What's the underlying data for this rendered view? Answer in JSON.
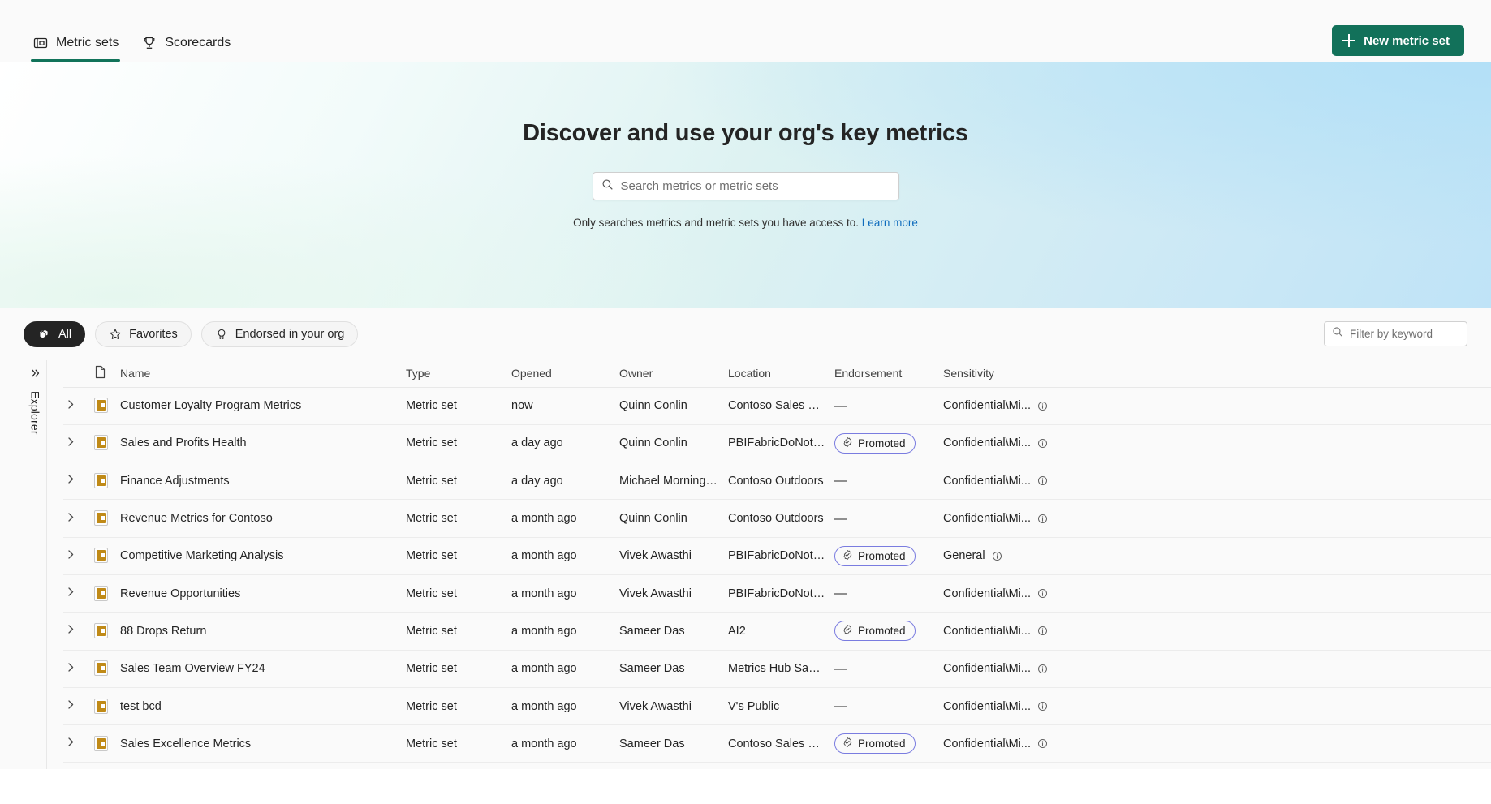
{
  "topbar": {
    "tabs": [
      {
        "label": "Metric sets",
        "icon": "metric-sets-icon",
        "active": true
      },
      {
        "label": "Scorecards",
        "icon": "trophy-icon",
        "active": false
      }
    ],
    "new_button": {
      "label": "New metric set",
      "icon": "plus-icon",
      "color": "#12715a"
    }
  },
  "hero": {
    "title": "Discover and use your org's key metrics",
    "search": {
      "placeholder": "Search metrics or metric sets",
      "value": "",
      "icon": "search-icon"
    },
    "note": "Only searches metrics and metric sets you have access to.",
    "note_link": "Learn more"
  },
  "filters": {
    "pills": [
      {
        "label": "All",
        "icon": "stacked-layers-icon",
        "active": true
      },
      {
        "label": "Favorites",
        "icon": "star-icon",
        "active": false
      },
      {
        "label": "Endorsed in your org",
        "icon": "endorsement-badge-icon",
        "active": false
      }
    ],
    "keyword": {
      "placeholder": "Filter by keyword",
      "value": "",
      "icon": "search-icon"
    }
  },
  "explorer": {
    "label": "Explorer",
    "icon": "double-chevron-right-icon"
  },
  "table": {
    "columns": [
      "Name",
      "Type",
      "Opened",
      "Owner",
      "Location",
      "Endorsement",
      "Sensitivity"
    ],
    "rows": [
      {
        "name": "Customer Loyalty Program Metrics",
        "type": "Metric set",
        "opened": "now",
        "owner": "Quinn Conlin",
        "location": "Contoso Sales Dem...",
        "endorsement": "—",
        "sensitivity": "Confidential\\Mi..."
      },
      {
        "name": "Sales and Profits Health",
        "type": "Metric set",
        "opened": "a day ago",
        "owner": "Quinn Conlin",
        "location": "PBIFabricDoNotDelete",
        "endorsement": "Promoted",
        "sensitivity": "Confidential\\Mi..."
      },
      {
        "name": "Finance Adjustments",
        "type": "Metric set",
        "opened": "a day ago",
        "owner": "Michael Morningstar",
        "location": "Contoso Outdoors",
        "endorsement": "—",
        "sensitivity": "Confidential\\Mi..."
      },
      {
        "name": "Revenue Metrics for Contoso",
        "type": "Metric set",
        "opened": "a month ago",
        "owner": "Quinn Conlin",
        "location": "Contoso Outdoors",
        "endorsement": "—",
        "sensitivity": "Confidential\\Mi..."
      },
      {
        "name": "Competitive Marketing Analysis",
        "type": "Metric set",
        "opened": "a month ago",
        "owner": "Vivek Awasthi",
        "location": "PBIFabricDoNotDelete",
        "endorsement": "Promoted",
        "sensitivity": "General"
      },
      {
        "name": "Revenue Opportunities",
        "type": "Metric set",
        "opened": "a month ago",
        "owner": "Vivek Awasthi",
        "location": "PBIFabricDoNotDelete",
        "endorsement": "—",
        "sensitivity": "Confidential\\Mi..."
      },
      {
        "name": "88 Drops Return",
        "type": "Metric set",
        "opened": "a month ago",
        "owner": "Sameer Das",
        "location": "AI2",
        "endorsement": "Promoted",
        "sensitivity": "Confidential\\Mi..."
      },
      {
        "name": "Sales Team Overview FY24",
        "type": "Metric set",
        "opened": "a month ago",
        "owner": "Sameer Das",
        "location": "Metrics Hub Samples",
        "endorsement": "—",
        "sensitivity": "Confidential\\Mi..."
      },
      {
        "name": "test bcd",
        "type": "Metric set",
        "opened": "a month ago",
        "owner": "Vivek Awasthi",
        "location": "V's Public",
        "endorsement": "—",
        "sensitivity": "Confidential\\Mi..."
      },
      {
        "name": "Sales Excellence Metrics",
        "type": "Metric set",
        "opened": "a month ago",
        "owner": "Sameer Das",
        "location": "Contoso Sales Dem...",
        "endorsement": "Promoted",
        "sensitivity": "Confidential\\Mi..."
      }
    ]
  }
}
